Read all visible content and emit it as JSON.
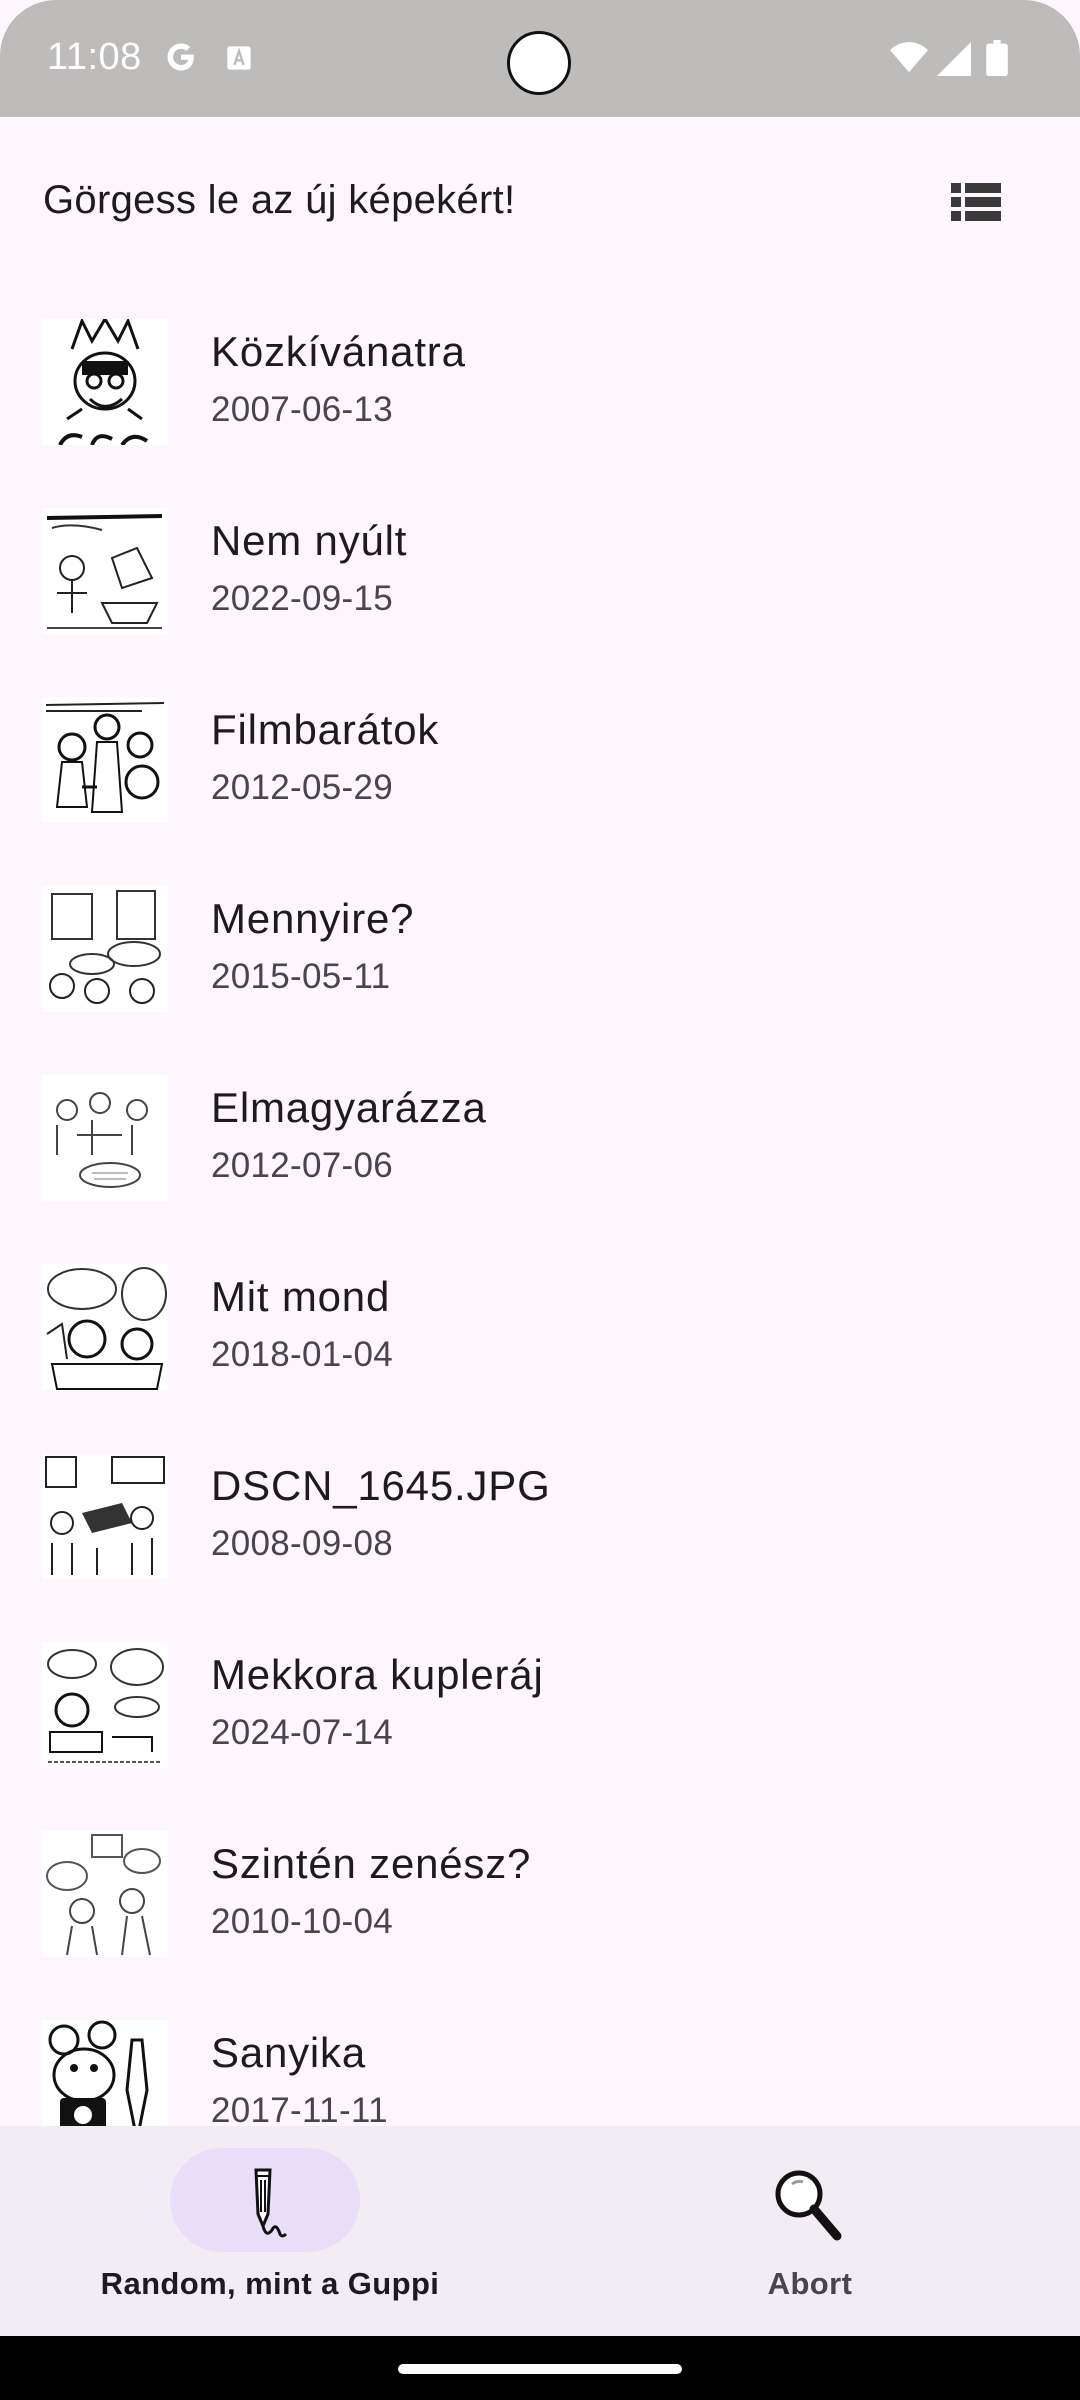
{
  "status_bar": {
    "time": "11:08",
    "icons": [
      "google-icon",
      "text-a-icon",
      "wifi-icon",
      "signal-icon",
      "battery-icon"
    ]
  },
  "header": {
    "title": "Görgess le az új képekért!",
    "view_toggle_icon": "list-view-icon"
  },
  "items": [
    {
      "title": "Közkívánatra",
      "date": "2007-06-13"
    },
    {
      "title": "Nem nyúlt",
      "date": "2022-09-15"
    },
    {
      "title": "Filmbarátok",
      "date": "2012-05-29"
    },
    {
      "title": "Mennyire?",
      "date": "2015-05-11"
    },
    {
      "title": "Elmagyarázza",
      "date": "2012-07-06"
    },
    {
      "title": "Mit mond",
      "date": "2018-01-04"
    },
    {
      "title": "DSCN_1645.JPG",
      "date": "2008-09-08"
    },
    {
      "title": "Mekkora kupleráj",
      "date": "2024-07-14"
    },
    {
      "title": "Szintén zenész?",
      "date": "2010-10-04"
    },
    {
      "title": "Sanyika",
      "date": "2017-11-11"
    }
  ],
  "bottom_nav": {
    "items": [
      {
        "label": "Random, mint a Guppi",
        "icon": "pencil-icon",
        "selected": true
      },
      {
        "label": "Abort",
        "icon": "magnifier-icon",
        "selected": false
      }
    ]
  },
  "colors": {
    "background": "#fdf7fd",
    "status_bar": "#bdbcbb",
    "nav_background": "#f2ecf4",
    "nav_selected_pill": "#e8def8",
    "text_primary": "#1d1b20",
    "text_secondary": "#49454f"
  }
}
